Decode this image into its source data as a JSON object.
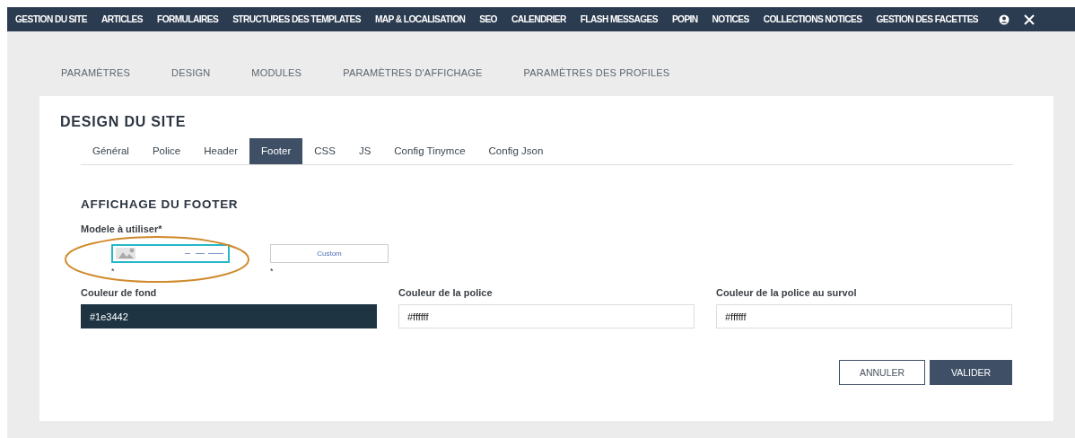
{
  "nav": {
    "items": [
      "GESTION DU SITE",
      "ARTICLES",
      "FORMULAIRES",
      "STRUCTURES DES TEMPLATES",
      "MAP & LOCALISATION",
      "SEO",
      "CALENDRIER",
      "FLASH MESSAGES",
      "POPIN",
      "NOTICES",
      "COLLECTIONS NOTICES",
      "GESTION DES FACETTES"
    ]
  },
  "top_tabs": [
    "PARAMÈTRES",
    "DESIGN",
    "MODULES",
    "PARAMÈTRES D'AFFICHAGE",
    "PARAMÈTRES DES PROFILES"
  ],
  "title": "DESIGN DU SITE",
  "sub_tabs": [
    {
      "label": "Général",
      "selected": false
    },
    {
      "label": "Police",
      "selected": false
    },
    {
      "label": "Header",
      "selected": false
    },
    {
      "label": "Footer",
      "selected": true
    },
    {
      "label": "CSS",
      "selected": false
    },
    {
      "label": "JS",
      "selected": false
    },
    {
      "label": "Config Tinymce",
      "selected": false
    },
    {
      "label": "Config Json",
      "selected": false
    }
  ],
  "section_title": "AFFICHAGE DU FOOTER",
  "model": {
    "label": "Modele à utiliser*",
    "options": [
      {
        "kind": "thumbnail",
        "selected": true,
        "note": "*"
      },
      {
        "kind": "text",
        "label": "Custom",
        "selected": false,
        "note": "*"
      }
    ]
  },
  "color_fields": [
    {
      "label": "Couleur de fond",
      "value": "#1e3442"
    },
    {
      "label": "Couleur de la police",
      "value": "#ffffff"
    },
    {
      "label": "Couleur de la police au survol",
      "value": "#ffffff"
    }
  ],
  "buttons": {
    "cancel": "ANNULER",
    "submit": "VALIDER"
  }
}
